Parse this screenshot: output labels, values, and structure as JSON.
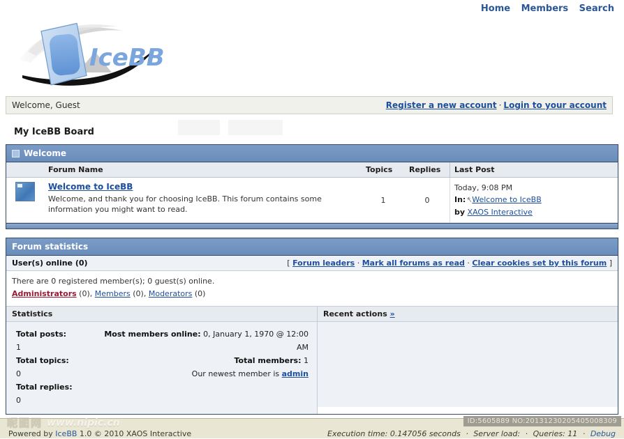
{
  "nav": {
    "items": [
      {
        "label": "Home",
        "name": "nav-home"
      },
      {
        "label": "Members",
        "name": "nav-members"
      },
      {
        "label": "Search",
        "name": "nav-search"
      }
    ]
  },
  "logo": {
    "text": "IceBB",
    "alt": "IceBB logo"
  },
  "welcome_bar": {
    "greeting": "Welcome, Guest",
    "register_label": "Register a new account",
    "separator": "·",
    "login_label": "Login to your account"
  },
  "board": {
    "title": "My IceBB Board"
  },
  "category": {
    "title": "Welcome",
    "toggle_icon": "collapse-box-icon"
  },
  "forum_table": {
    "columns": [
      "Forum Name",
      "Topics",
      "Replies",
      "Last Post"
    ],
    "rows": [
      {
        "icon": "forum-folder-icon",
        "name": "Welcome to IceBB",
        "description": "Welcome, and thank you for choosing IceBB. This forum contains some information you might want to read.",
        "topics": "1",
        "replies": "0",
        "last_post": {
          "time": "Today, 9:08 PM",
          "in_label": "In:",
          "goto_icon": "goto-arrow-icon",
          "topic": "Welcome to IceBB",
          "by_label": "by",
          "author": "XAOS Interactive"
        }
      }
    ]
  },
  "statistics_panel": {
    "title": "Forum statistics",
    "online_header": "User(s) online (0)",
    "tool_links": {
      "open_bracket": "[",
      "close_bracket": "]",
      "separator": "·",
      "items": [
        {
          "label": "Forum leaders",
          "name": "forum-leaders-link"
        },
        {
          "label": "Mark all forums as read",
          "name": "mark-all-read-link"
        },
        {
          "label": "Clear cookies set by this forum",
          "name": "clear-cookies-link"
        }
      ]
    },
    "online_summary": "There are 0 registered member(s); 0 guest(s) online.",
    "groups": [
      {
        "label": "Administrators",
        "count": "(0)",
        "style": "admin"
      },
      {
        "label": "Members",
        "count": "(0)",
        "style": "link"
      },
      {
        "label": "Moderators",
        "count": "(0)",
        "style": "link"
      }
    ],
    "group_separator": ", ",
    "stats_subhead": "Statistics",
    "recent_subhead": "Recent actions",
    "recent_more": "»",
    "left_stats": [
      {
        "label": "Total posts:",
        "value": "1"
      },
      {
        "label": "Total topics:",
        "value": "0"
      },
      {
        "label": "Total replies:",
        "value": "0"
      }
    ],
    "right_stats": [
      {
        "label": "Most members online:",
        "value": "0, January 1, 1970 @ 12:00 AM"
      },
      {
        "label": "Total members:",
        "value": "1"
      }
    ],
    "newest_member_prefix": "Our newest member is",
    "newest_member": "admin"
  },
  "footer": {
    "powered_prefix": "Powered by",
    "powered_link": "IceBB",
    "powered_suffix": "1.0 © 2010 XAOS Interactive",
    "execution_time": "Execution time: 0.147056 seconds",
    "server_load": "Server load:",
    "queries": "Queries: 11",
    "debug_label": "Debug",
    "separator": "·"
  },
  "watermark": {
    "site_cn": "昵图网",
    "site_url": "www.nipic.cn",
    "id_badge": "ID:5605889 NO:20131230205405008309"
  },
  "colors": {
    "header_blue": "#6a8cba",
    "link_blue": "#1d4f9e",
    "admin_red": "#9c1733",
    "panel_border": "#31496b",
    "footer_bg": "#e9e6d4"
  }
}
